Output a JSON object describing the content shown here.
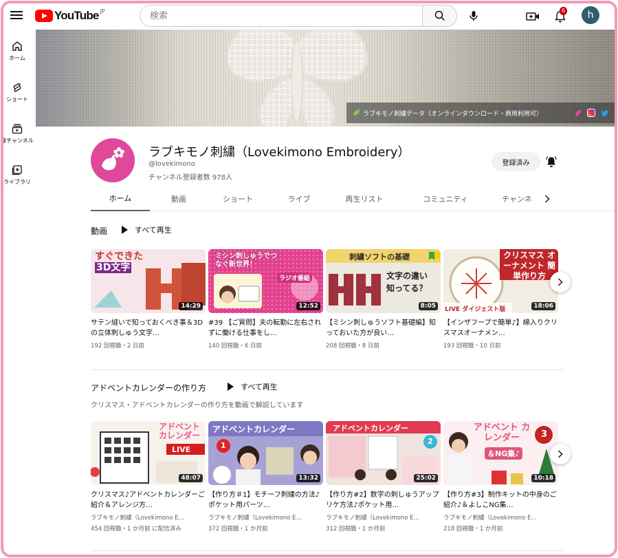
{
  "header": {
    "logo_text": "YouTube",
    "logo_region": "JP",
    "search_placeholder": "検索",
    "notification_count": "6",
    "avatar_letter": "h"
  },
  "rail": [
    {
      "label": "ホーム",
      "icon": "home-icon"
    },
    {
      "label": "ショート",
      "icon": "shorts-icon"
    },
    {
      "label": "登録チャンネル",
      "icon": "subscriptions-icon"
    },
    {
      "label": "ライブラリ",
      "icon": "library-icon"
    }
  ],
  "banner": {
    "overlay_text": "ラブキモノ刺繍データ（オンラインダウンロード・商用利用可）",
    "link_icons": [
      "lovekimono-icon",
      "instagram-icon",
      "twitter-icon"
    ]
  },
  "channel": {
    "name": "ラブキモノ刺繍（Lovekimono Embroidery）",
    "handle": "@lovekimono",
    "subscribers": "チャンネル登録者数 978人",
    "subscribe_label": "登録済み",
    "avatar_color": "#e0489a"
  },
  "tabs": [
    "ホーム",
    "動画",
    "ショート",
    "ライブ",
    "再生リスト",
    "コミュニティ",
    "チャンネ"
  ],
  "sections": [
    {
      "title": "動画",
      "play_all": "すべて再生",
      "videos": [
        {
          "title": "サテン縫いで知っておくべき事＆3Dの立体刺しゅう文字…",
          "meta": "192 回視聴・2 日前",
          "duration": "14:29",
          "thumb_text": "すぐできた 3D文字"
        },
        {
          "title": "#39 【ご質問】夫の転勤に左右されずに働ける仕事をし…",
          "meta": "140 回視聴・6 日前",
          "duration": "12:52",
          "thumb_text": "ミシン刺しゅうでつなぐ新世界！ ラジオ番組(Podcast)"
        },
        {
          "title": "【ミシン刺しゅうソフト基礎編】知っておいた方が良い…",
          "meta": "208 回視聴・8 日前",
          "duration": "8:05",
          "thumb_text": "刺繍ソフトの基礎 文字の違い 知ってる？"
        },
        {
          "title": "【インザフープで簡単♪】綿入りクリスマスオーナメン…",
          "meta": "193 回視聴・10 日前",
          "duration": "18:06",
          "thumb_text": "クリスマス オーナメント 簡単作り方"
        }
      ]
    },
    {
      "title": "アドベントカレンダーの作り方",
      "play_all": "すべて再生",
      "description": "クリスマス・アドベントカレンダーの作り方を動画で解説しています",
      "videos": [
        {
          "title": "クリスマス♪アドベントカレンダーご紹介＆アレンジ方…",
          "channel": "ラブキモノ刺繍（Lovekimono E…",
          "meta": "454 回視聴・1 か月前 に配信済み",
          "duration": "48:07",
          "thumb_text": "アドベント カレンダー LIVE"
        },
        {
          "title": "【作り方＃1】モチーフ刺繍の方法♪ポケット用パーツ…",
          "channel": "ラブキモノ刺繍（Lovekimono E…",
          "meta": "372 回視聴・1 か月前",
          "duration": "13:32",
          "thumb_text": "アドベントカレンダー 1"
        },
        {
          "title": "【作り方#2】数字の刺しゅうアップリケ方法♪ポケット用…",
          "channel": "ラブキモノ刺繍（Lovekimono E…",
          "meta": "312 回視聴・1 か月前",
          "duration": "25:02",
          "thumb_text": "アドベントカレンダー 2"
        },
        {
          "title": "【作り方#3】制作キットの中身のご紹介♪＆よしこNG集…",
          "channel": "ラブキモノ刺繍（Lovekimono E…",
          "meta": "218 回視聴・1 か月前",
          "duration": "10:18",
          "thumb_text": "アドベント カレンダー 3 ＆NG集♪"
        }
      ]
    }
  ],
  "colors": {
    "accent": "#ff0000",
    "frame": "#f29ab7",
    "brand_pink": "#e0489a"
  }
}
